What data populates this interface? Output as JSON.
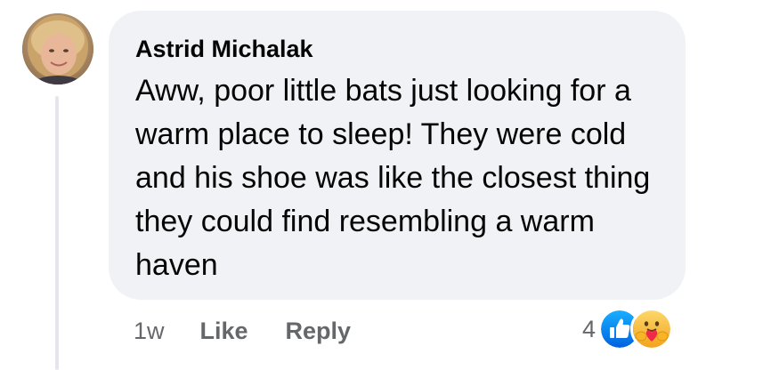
{
  "comment": {
    "author": "Astrid Michalak",
    "text": "Aww, poor little bats just looking for a warm place to sleep! They were cold and his shoe was like the closest thing they could find resembling a warm haven",
    "timestamp": "1w",
    "like_label": "Like",
    "reply_label": "Reply",
    "reaction_count": "4",
    "reactions": [
      "like-icon",
      "care-icon"
    ]
  },
  "colors": {
    "bubble": "#f0f2f5",
    "text": "#050505",
    "secondary_text": "#65676b",
    "like_blue": "#1877f2",
    "care_yellow": "#f7b125"
  }
}
